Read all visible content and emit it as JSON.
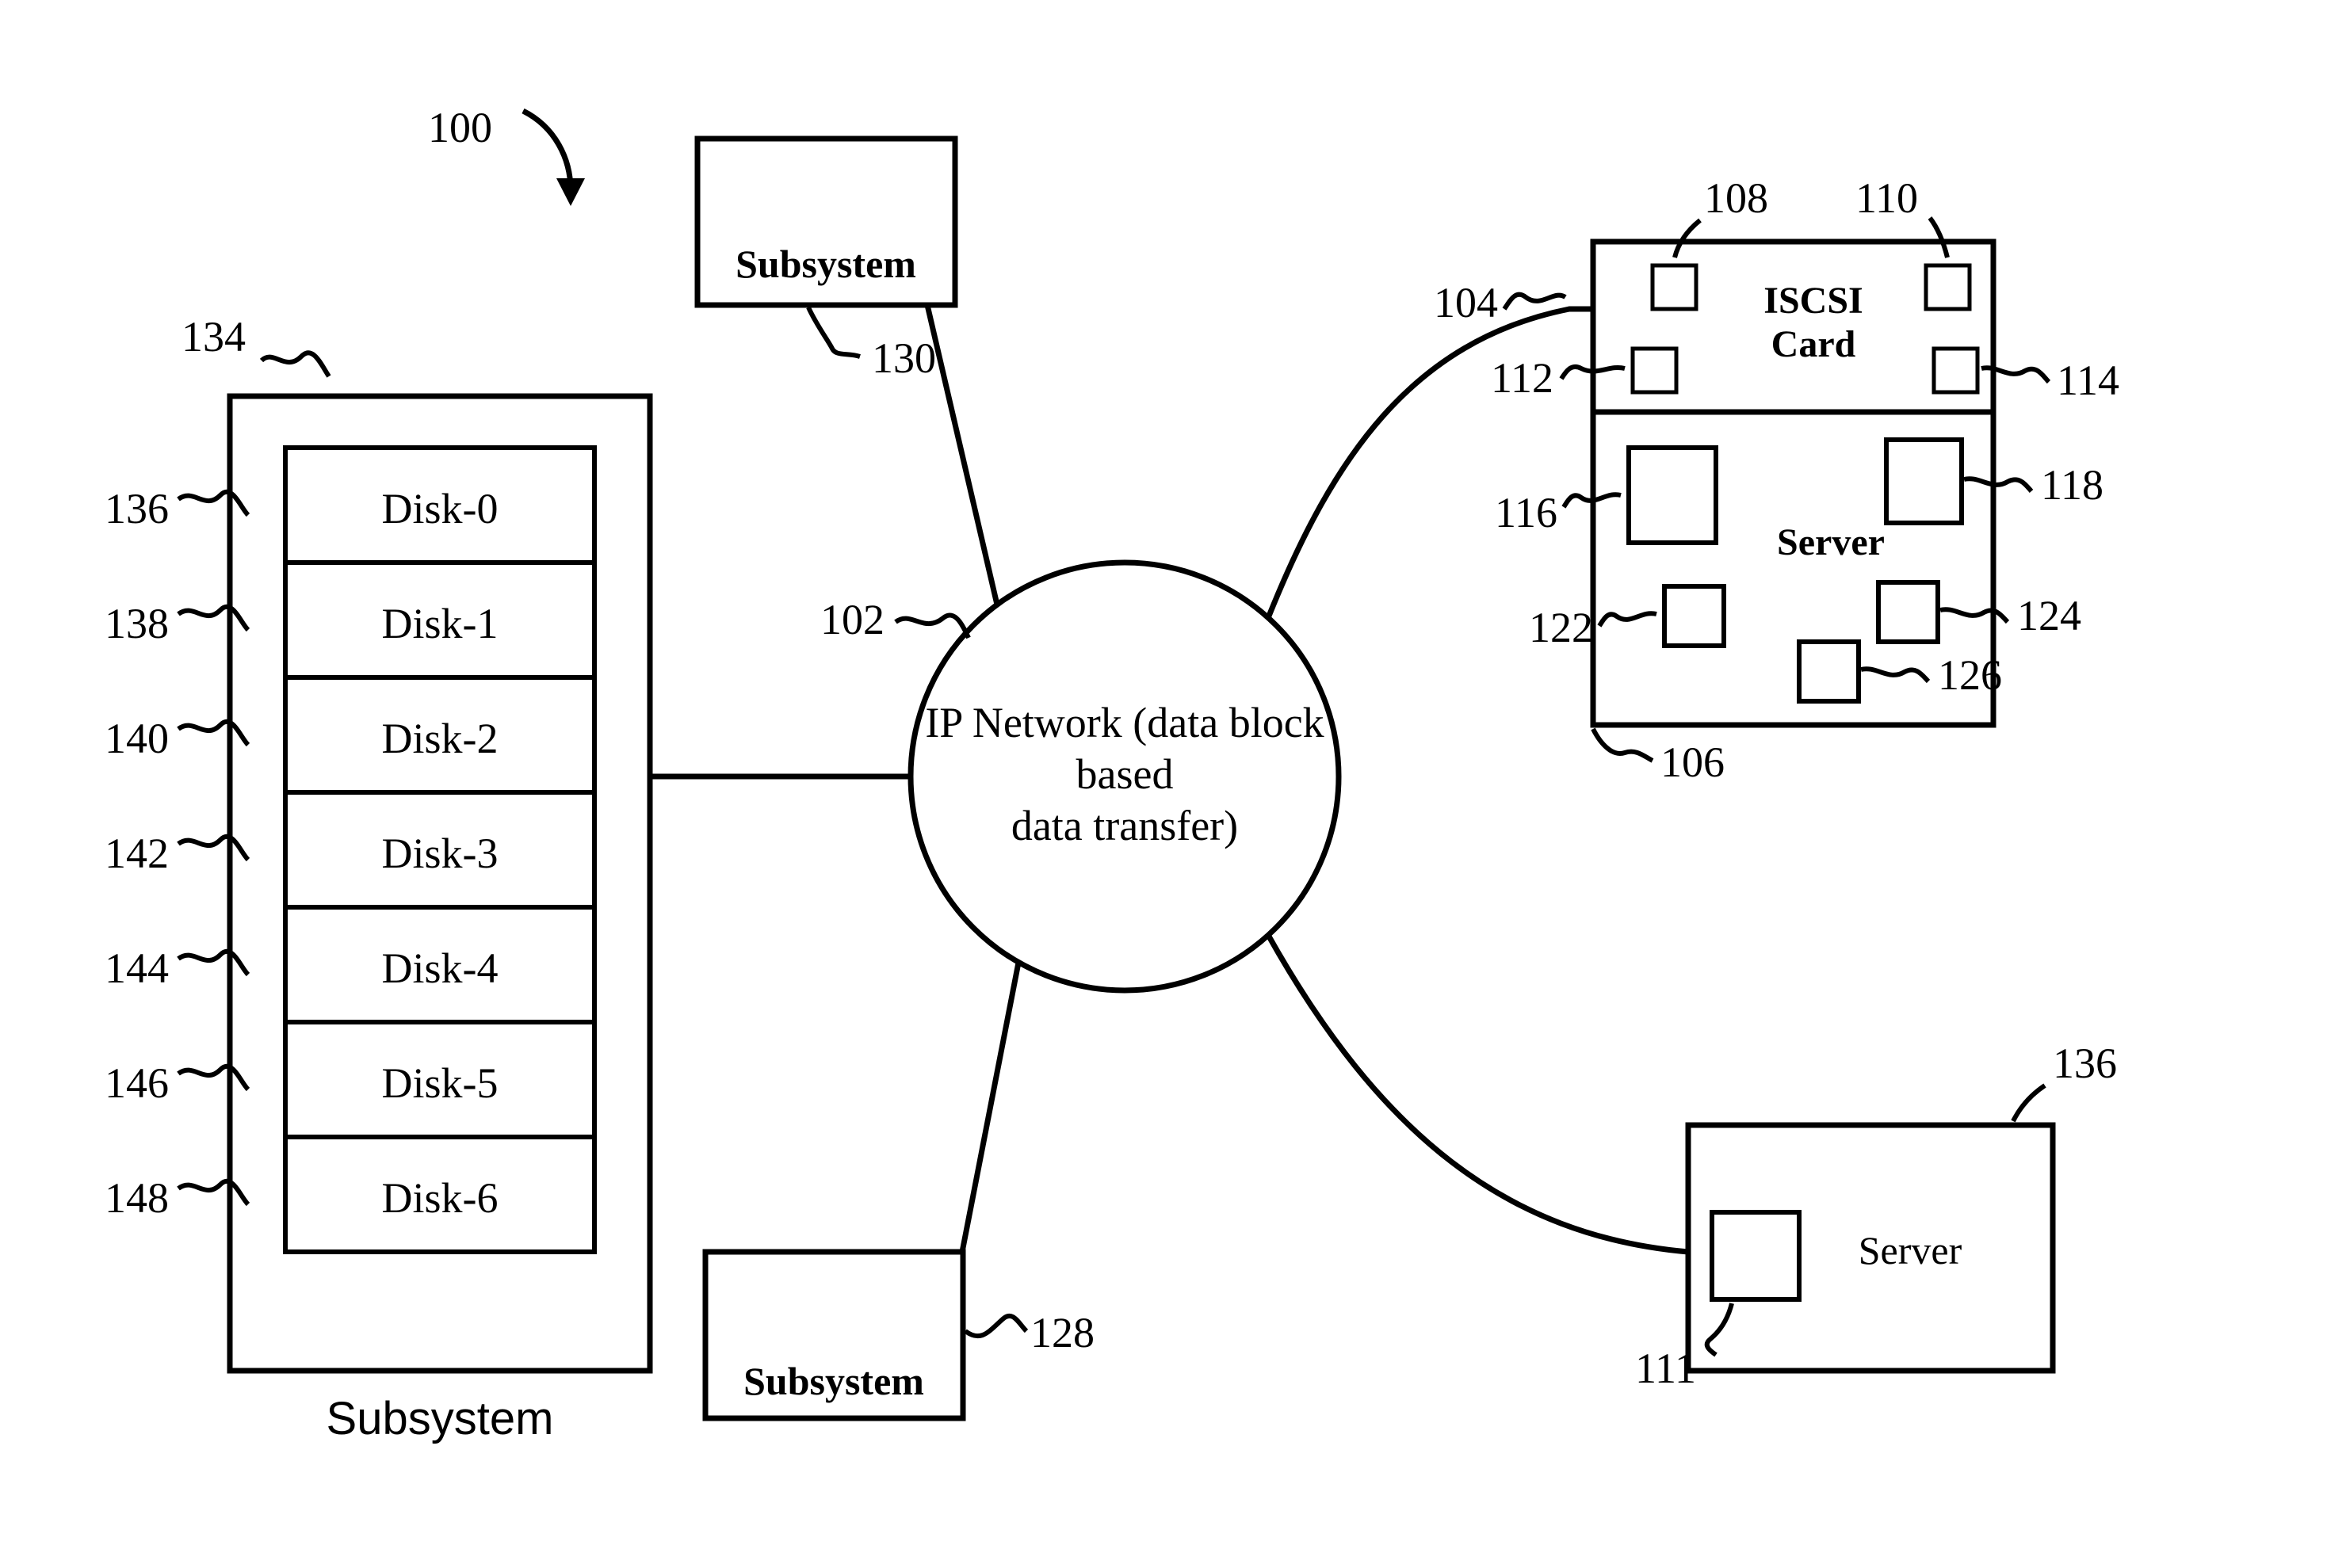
{
  "figure_ref": "100",
  "network": {
    "ref": "102",
    "label_line1": "IP Network (data block",
    "label_line2": "based",
    "label_line3": "data transfer)"
  },
  "subsystem_top": {
    "label": "Subsystem",
    "ref": "130"
  },
  "subsystem_bottom": {
    "label": "Subsystem",
    "ref": "128"
  },
  "subsystem_left": {
    "label": "Subsystem",
    "box_ref": "134",
    "disks": [
      {
        "label": "Disk-0",
        "ref": "136"
      },
      {
        "label": "Disk-1",
        "ref": "138"
      },
      {
        "label": "Disk-2",
        "ref": "140"
      },
      {
        "label": "Disk-3",
        "ref": "142"
      },
      {
        "label": "Disk-4",
        "ref": "144"
      },
      {
        "label": "Disk-5",
        "ref": "146"
      },
      {
        "label": "Disk-6",
        "ref": "148"
      }
    ]
  },
  "server_main": {
    "ref": "106",
    "label": "Server",
    "card": {
      "ref": "104",
      "label_line1": "ISCSI",
      "label_line2": "Card",
      "chips": [
        {
          "ref": "108"
        },
        {
          "ref": "110"
        },
        {
          "ref": "112"
        },
        {
          "ref": "114"
        }
      ]
    },
    "body_chips": [
      {
        "ref": "116"
      },
      {
        "ref": "118"
      },
      {
        "ref": "122"
      },
      {
        "ref": "124"
      },
      {
        "ref": "126"
      }
    ]
  },
  "server_secondary": {
    "ref": "136",
    "label": "Server",
    "chip_ref": "111"
  }
}
